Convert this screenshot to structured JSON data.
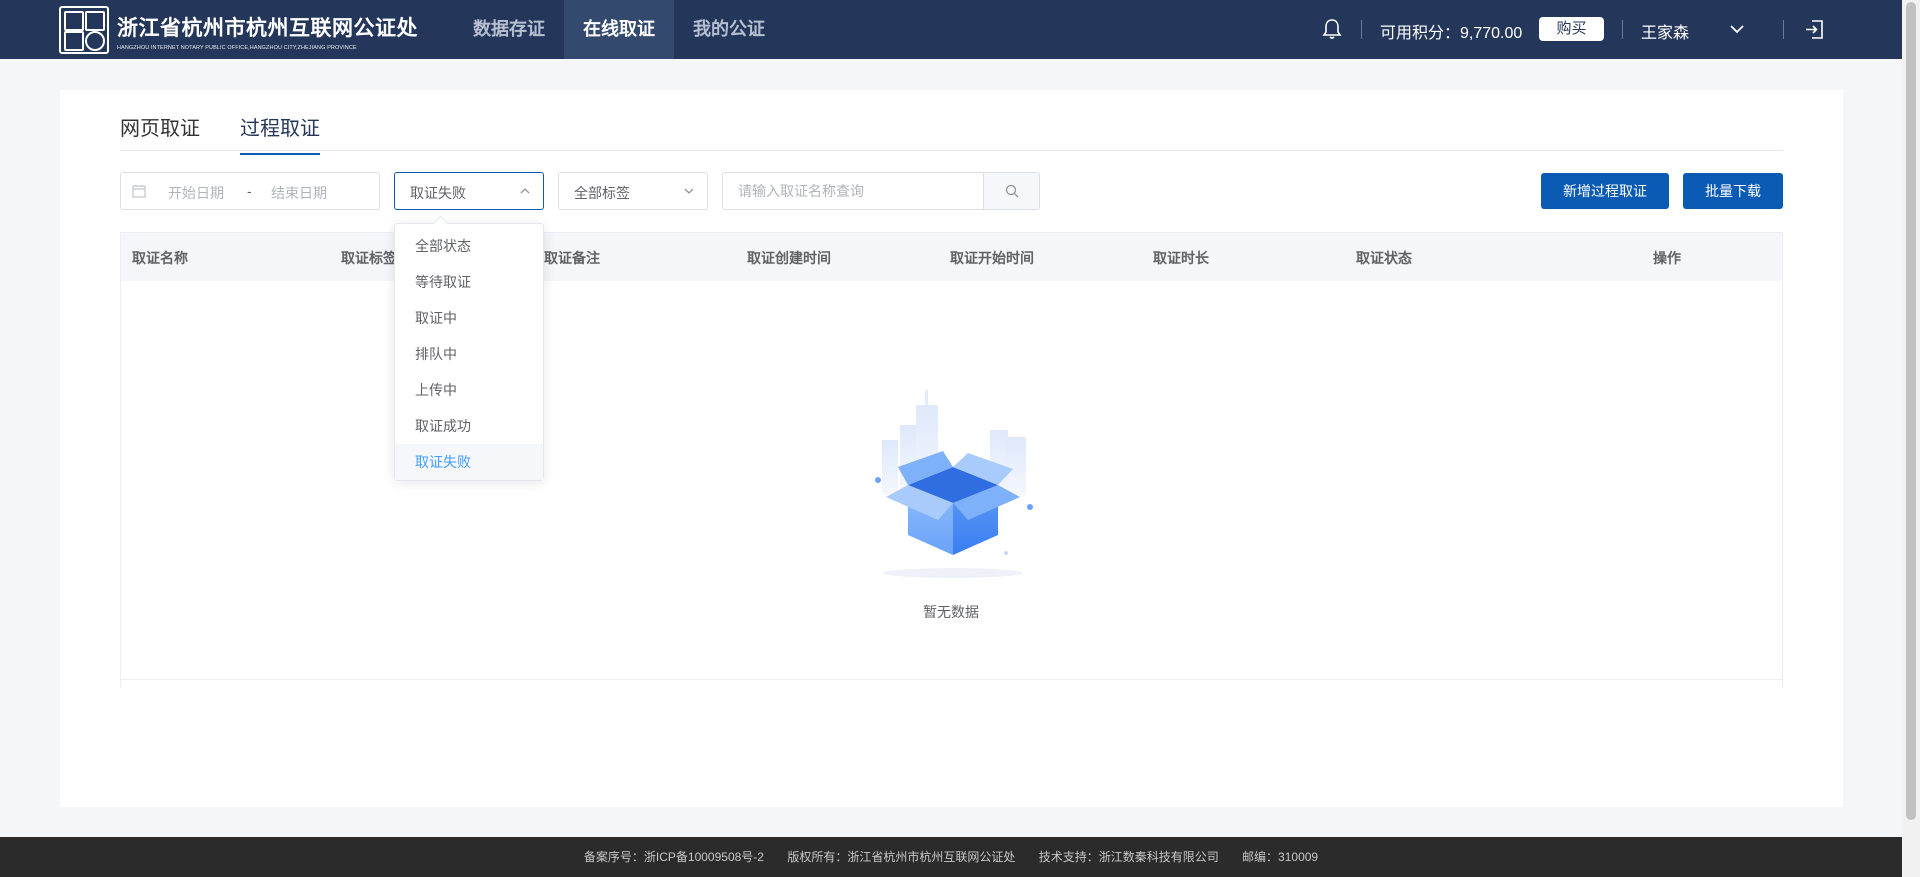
{
  "header": {
    "brand_cn": "浙江省杭州市杭州互联网公证处",
    "brand_en": "HANGZHOU INTERNET NOTARY PUBLIC OFFICE,HANGZHOU CITY,ZHEJIANG PROVINCE",
    "nav": [
      {
        "label": "数据存证",
        "active": false
      },
      {
        "label": "在线取证",
        "active": true
      },
      {
        "label": "我的公证",
        "active": false
      }
    ],
    "points_label": "可用积分：9,770.00",
    "buy_label": "购买",
    "user_name": "王家森"
  },
  "tabs": [
    {
      "label": "网页取证",
      "active": false
    },
    {
      "label": "过程取证",
      "active": true
    }
  ],
  "filters": {
    "start_date_placeholder": "开始日期",
    "date_separator": "-",
    "end_date_placeholder": "结束日期",
    "status_value": "取证失败",
    "tag_value": "全部标签",
    "search_placeholder": "请输入取证名称查询"
  },
  "actions": {
    "add_label": "新增过程取证",
    "download_label": "批量下载"
  },
  "table": {
    "columns": [
      "取证名称",
      "取证标签",
      "取证备注",
      "取证创建时间",
      "取证开始时间",
      "取证时长",
      "取证状态",
      "操作"
    ],
    "rows": [],
    "empty_text": "暂无数据"
  },
  "status_dropdown": {
    "options": [
      "全部状态",
      "等待取证",
      "取证中",
      "排队中",
      "上传中",
      "取证成功",
      "取证失败"
    ],
    "selected": "取证失败"
  },
  "footer": {
    "icp": "备案序号：浙ICP备10009508号-2",
    "copyright": "版权所有：浙江省杭州市杭州互联网公证处",
    "support": "技术支持：浙江数秦科技有限公司",
    "postcode": "邮编：310009"
  },
  "colors": {
    "header_bg": "#24375a",
    "primary": "#0b5bb5",
    "selected_option": "#409eff"
  }
}
